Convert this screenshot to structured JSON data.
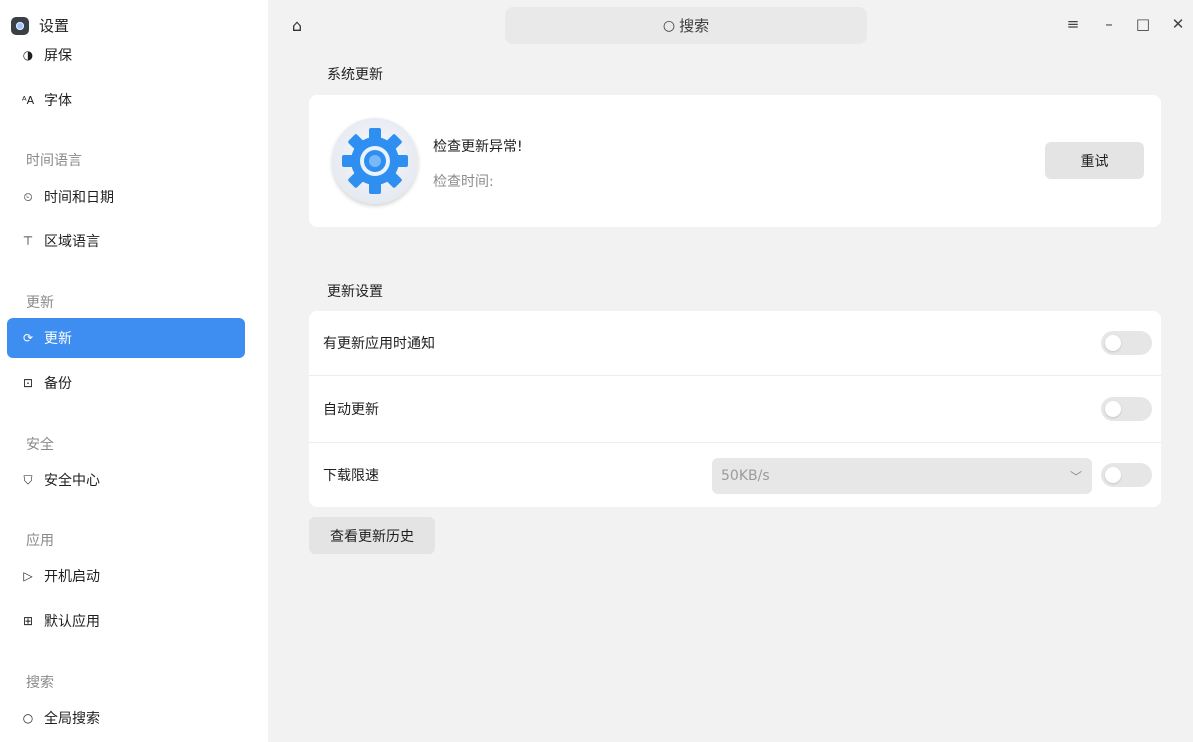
{
  "app": {
    "title": "设置"
  },
  "sidebar": {
    "items": [
      {
        "label": "屏保",
        "icon": "screensaver-icon"
      },
      {
        "label": "字体",
        "icon": "font-icon"
      },
      {
        "group": "时间语言"
      },
      {
        "label": "时间和日期",
        "icon": "clock-icon"
      },
      {
        "label": "区域语言",
        "icon": "region-language-icon"
      },
      {
        "group": "更新"
      },
      {
        "label": "更新",
        "icon": "refresh-icon",
        "active": true
      },
      {
        "label": "备份",
        "icon": "backup-icon"
      },
      {
        "group": "安全"
      },
      {
        "label": "安全中心",
        "icon": "shield-icon"
      },
      {
        "group": "应用"
      },
      {
        "label": "开机启动",
        "icon": "startup-icon"
      },
      {
        "label": "默认应用",
        "icon": "grid-apps-icon"
      },
      {
        "group": "搜索"
      },
      {
        "label": "全局搜索",
        "icon": "search-icon"
      }
    ]
  },
  "titlebar": {
    "search_label": "搜索",
    "controls": [
      "menu-icon",
      "minimize-icon",
      "maximize-icon",
      "close-icon"
    ]
  },
  "system_update": {
    "section_title": "系统更新",
    "status": "检查更新异常!",
    "check_time_label": "检查时间:",
    "retry_label": "重试"
  },
  "update_settings": {
    "section_title": "更新设置",
    "rows": [
      {
        "label": "有更新应用时通知",
        "enabled": false
      },
      {
        "label": "自动更新",
        "enabled": false
      },
      {
        "label": "下载限速",
        "enabled": false,
        "speed_value": "50KB/s"
      }
    ]
  },
  "history_button_label": "查看更新历史",
  "colors": {
    "accent": "#3d8ef0",
    "background": "#f2f2f2",
    "card": "#ffffff"
  }
}
